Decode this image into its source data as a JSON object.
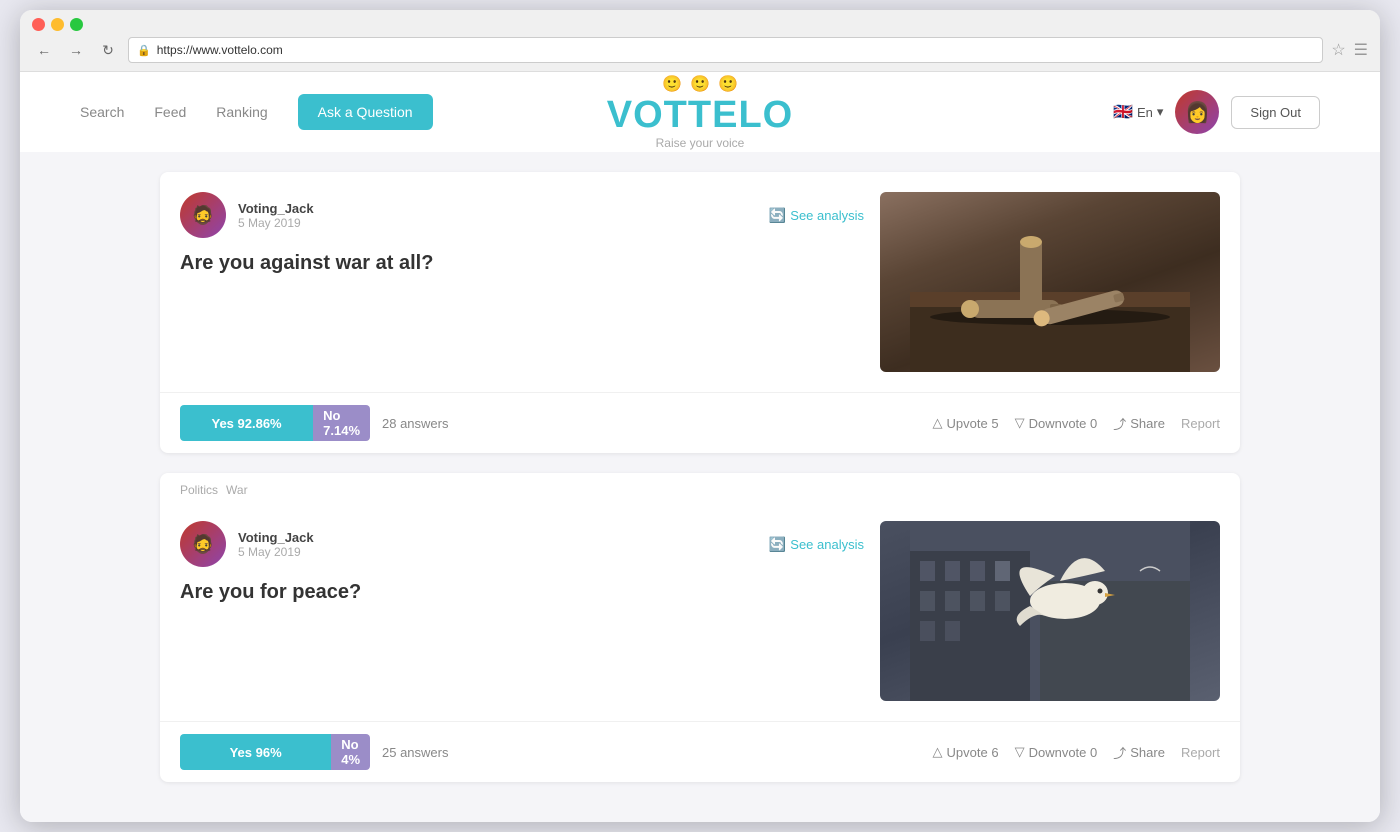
{
  "browser": {
    "url": "https://www.vottelo.com",
    "back_label": "←",
    "forward_label": "→",
    "reload_label": "↺"
  },
  "header": {
    "nav_search": "Search",
    "nav_feed": "Feed",
    "nav_ranking": "Ranking",
    "nav_ask": "Ask a Question",
    "logo": "VOTTELO",
    "tagline": "Raise your voice",
    "lang": "En",
    "sign_out": "Sign Out"
  },
  "posts": [
    {
      "id": "post-1",
      "tags": [],
      "username": "Voting_Jack",
      "date": "5 May 2019",
      "see_analysis": "See analysis",
      "question": "Are you against war at all?",
      "yes_label": "Yes 92.86%",
      "no_label": "No 7.14%",
      "yes_pct": 92.86,
      "no_pct": 7.14,
      "answers": "28 answers",
      "upvote_label": "Upvote 5",
      "downvote_label": "Downvote 0",
      "share_label": "Share",
      "report_label": "Report",
      "image_type": "bullets"
    },
    {
      "id": "post-2",
      "tags": [
        "Politics",
        "War"
      ],
      "username": "Voting_Jack",
      "date": "5 May 2019",
      "see_analysis": "See analysis",
      "question": "Are you for peace?",
      "yes_label": "Yes 96%",
      "no_label": "No 4%",
      "yes_pct": 96,
      "no_pct": 4,
      "answers": "25 answers",
      "upvote_label": "Upvote 6",
      "downvote_label": "Downvote 0",
      "share_label": "Share",
      "report_label": "Report",
      "image_type": "dove"
    }
  ]
}
